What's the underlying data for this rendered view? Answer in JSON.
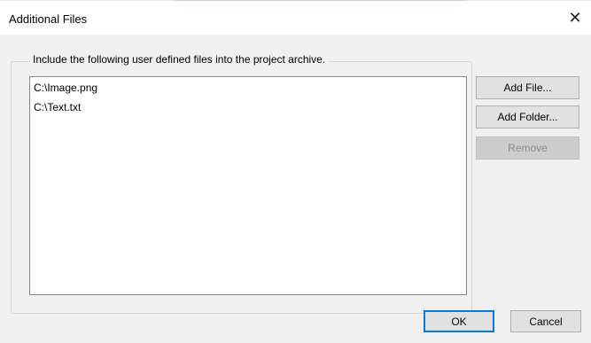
{
  "window": {
    "title": "Additional Files",
    "close_glyph": "✕"
  },
  "group": {
    "caption": "Include the following user defined files into the project archive."
  },
  "files": [
    {
      "label": "C:\\Image.png"
    },
    {
      "label": "C:\\Text.txt"
    }
  ],
  "side_buttons": {
    "add_file": "Add File...",
    "add_folder": "Add Folder...",
    "remove": "Remove"
  },
  "footer_buttons": {
    "ok": "OK",
    "cancel": "Cancel"
  },
  "colors": {
    "dialog_bg": "#f0f0f0",
    "default_button_border": "#0078d7",
    "disabled_text": "#8b8b8b"
  }
}
